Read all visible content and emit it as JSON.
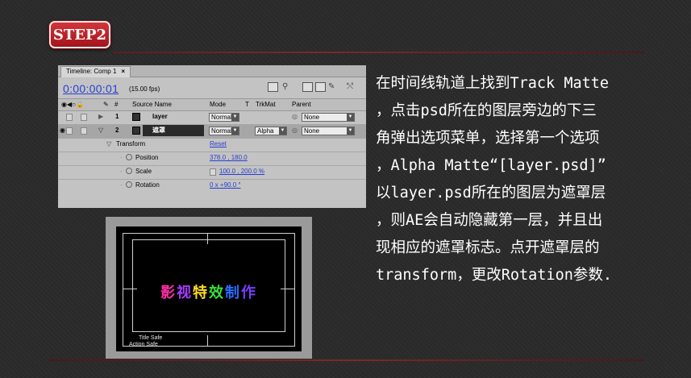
{
  "step_label": "STEP2",
  "timeline": {
    "tab_label": "Timeline: Comp 1",
    "tab_close": "×",
    "timecode": "0:00:00:01",
    "fps": "(15.00 fps)",
    "columns": {
      "number": "#",
      "source": "Source Name",
      "mode": "Mode",
      "t": "T",
      "trkmat": "TrkMat",
      "parent": "Parent"
    },
    "layers": [
      {
        "num": "1",
        "name": "layer",
        "mode": "Normal",
        "trkmat": "",
        "parent": "None"
      },
      {
        "num": "2",
        "name": "遮罩",
        "mode": "Normal",
        "trkmat": "Alpha",
        "parent": "None"
      }
    ],
    "transform": {
      "label": "Transform",
      "reset": "Reset",
      "props": [
        {
          "name": "Position",
          "value": "378.0 , 180.0"
        },
        {
          "name": "Scale",
          "value": "100.0 , 200.0 %"
        },
        {
          "name": "Rotation",
          "value": "0 x +90.0 °"
        }
      ]
    }
  },
  "preview": {
    "text_chars": [
      "影",
      "视",
      "特",
      "效",
      "制",
      "作"
    ],
    "text_colors": [
      "#ff2fa8",
      "#a63cff",
      "#ffdd22",
      "#38e038",
      "#2a6cff",
      "#7a3cff"
    ],
    "title_safe": "Title Safe",
    "action_safe": "Action Safe"
  },
  "description": [
    "在时间线轨道上找到Track Matte",
    "，点击psd所在的图层旁边的下三",
    "角弹出选项菜单，选择第一个选项",
    "，Alpha Matte“[layer.psd]”",
    "以layer.psd所在的图层为遮罩层",
    "，则AE会自动隐藏第一层，并且出",
    "现相应的遮罩标志。点开遮罩层的",
    "transform，更改Rotation参数."
  ]
}
